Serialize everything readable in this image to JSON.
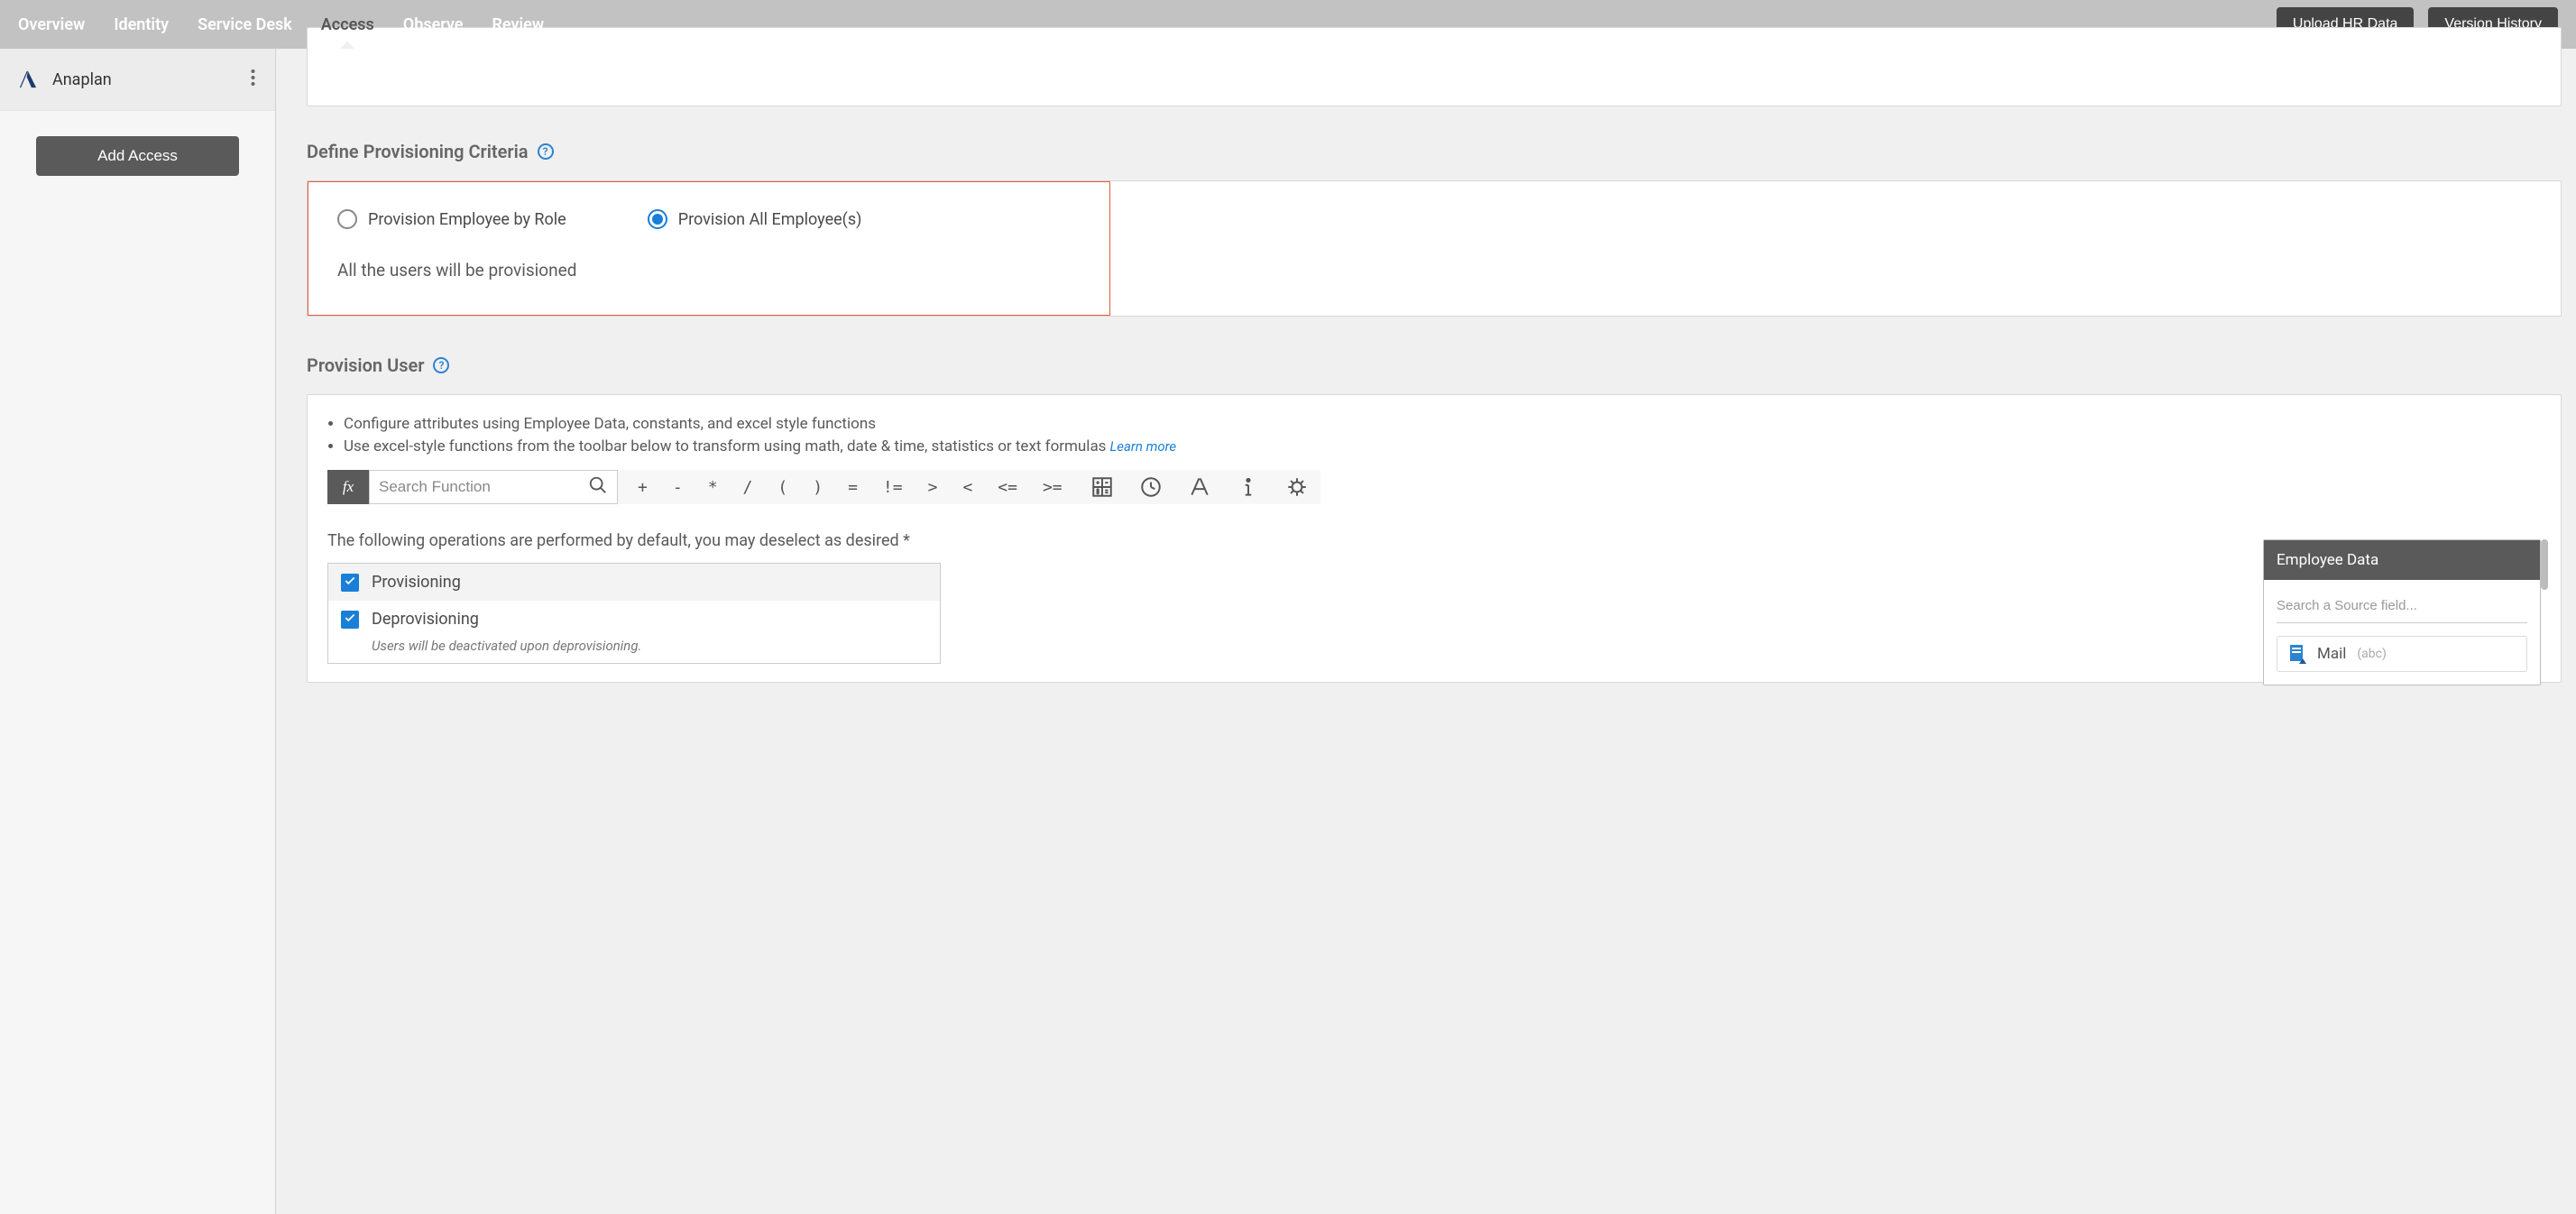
{
  "nav": {
    "tabs": [
      "Overview",
      "Identity",
      "Service Desk",
      "Access",
      "Observe",
      "Review"
    ],
    "active_index": 3,
    "upload": "Upload HR Data",
    "version": "Version History"
  },
  "sidebar": {
    "app_name": "Anaplan",
    "add_access": "Add Access"
  },
  "criteria": {
    "title": "Define Provisioning Criteria",
    "opt_by_role": "Provision Employee by Role",
    "opt_all": "Provision All Employee(s)",
    "selected": "all",
    "note": "All the users will be provisioned"
  },
  "provision_user": {
    "title": "Provision User",
    "bullet1": "Configure attributes using Employee Data, constants, and excel style functions",
    "bullet2": "Use excel-style functions from the toolbar below to transform using math, date & time, statistics or text formulas",
    "learn_more": "Learn more",
    "search_placeholder": "Search Function",
    "operators": [
      "+",
      "-",
      "*",
      "/",
      "(",
      ")",
      "=",
      "!=",
      ">",
      "<",
      "<=",
      ">="
    ],
    "ops_caption": "The following operations are performed by default, you may deselect as desired *",
    "op_provisioning": "Provisioning",
    "op_deprovisioning": "Deprovisioning",
    "deprov_note": "Users will be deactivated upon deprovisioning."
  },
  "employee_data": {
    "title": "Employee Data",
    "search_placeholder": "Search a Source field...",
    "item_name": "Mail",
    "item_type": "(abc)"
  }
}
